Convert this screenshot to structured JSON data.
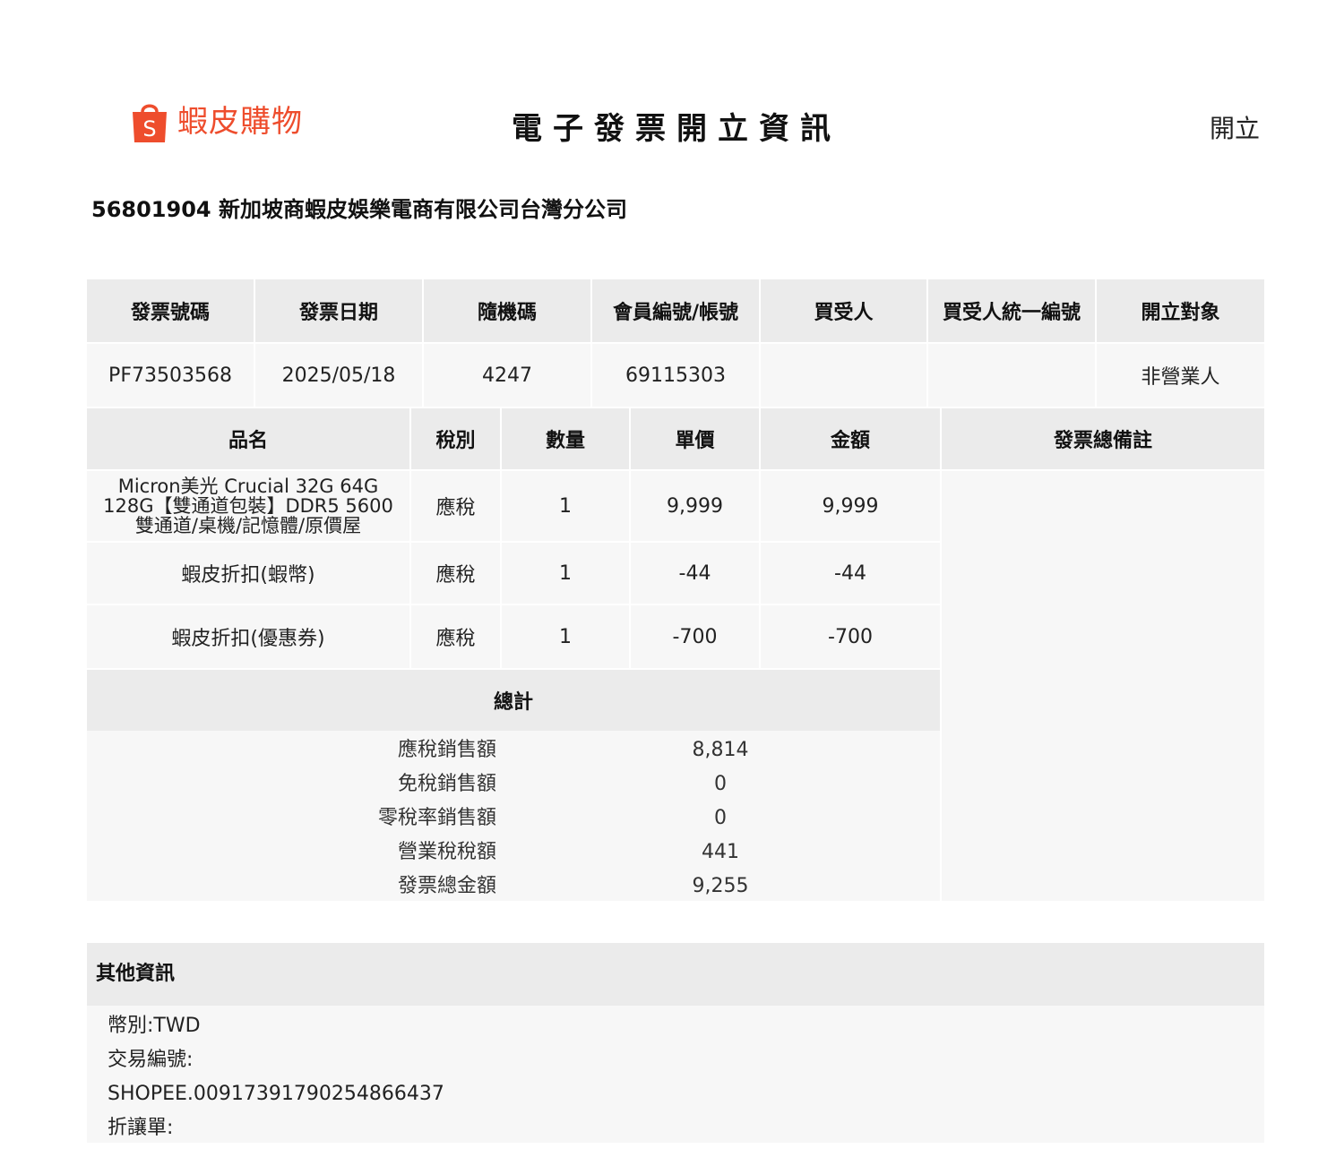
{
  "header": {
    "logo_text": "蝦皮購物",
    "logo_letter": "S",
    "title": "電子發票開立資訊",
    "status": "開立",
    "brand_color": "#ee4d2d"
  },
  "seller": "56801904 新加坡商蝦皮娛樂電商有限公司台灣分公司",
  "invoice": {
    "headers": [
      "發票號碼",
      "發票日期",
      "隨機碼",
      "會員編號/帳號",
      "買受人",
      "買受人統一編號",
      "開立對象"
    ],
    "values": [
      "PF73503568",
      "2025/05/18",
      "4247",
      "69115303",
      "",
      "",
      "非營業人"
    ]
  },
  "items": {
    "headers": [
      "品名",
      "稅別",
      "數量",
      "單價",
      "金額",
      "發票總備註"
    ],
    "rows": [
      {
        "name": "Micron美光 Crucial 32G 64G 128G【雙通道包裝】DDR5 5600 雙通道/桌機/記憶體/原價屋",
        "tax": "應稅",
        "qty": "1",
        "price": "9,999",
        "amount": "9,999"
      },
      {
        "name": "蝦皮折扣(蝦幣)",
        "tax": "應稅",
        "qty": "1",
        "price": "-44",
        "amount": "-44"
      },
      {
        "name": "蝦皮折扣(優惠券)",
        "tax": "應稅",
        "qty": "1",
        "price": "-700",
        "amount": "-700"
      }
    ],
    "remark": ""
  },
  "summary": {
    "title": "總計",
    "rows": [
      {
        "label": "應稅銷售額",
        "value": "8,814"
      },
      {
        "label": "免稅銷售額",
        "value": "0"
      },
      {
        "label": "零稅率銷售額",
        "value": "0"
      },
      {
        "label": "營業稅稅額",
        "value": "441"
      },
      {
        "label": "發票總金額",
        "value": "9,255"
      }
    ]
  },
  "other": {
    "title": "其他資訊",
    "lines": [
      "幣別:TWD",
      "交易編號:",
      "SHOPEE.00917391790254866437",
      "折讓單:"
    ]
  }
}
